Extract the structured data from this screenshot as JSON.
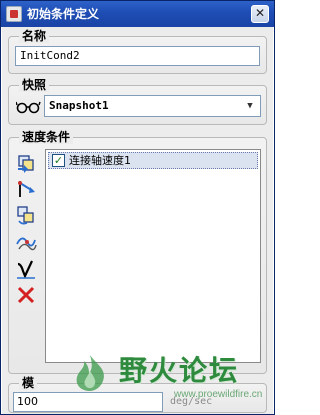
{
  "window": {
    "title": "初始条件定义",
    "close_label": "✕"
  },
  "name_group": {
    "legend": "名称",
    "value": "InitCond2"
  },
  "snapshot_group": {
    "legend": "快照",
    "selected": "Snapshot1"
  },
  "velocity_group": {
    "legend": "速度条件",
    "items": [
      {
        "label": "连接轴速度1",
        "checked": true
      }
    ]
  },
  "magnitude_group": {
    "legend": "模",
    "value": "100",
    "unit": "deg/sec"
  },
  "watermark": {
    "text": "野火论坛",
    "url": "www.proewildfire.cn"
  },
  "colors": {
    "title_bar": "#1e4db4",
    "dialog_bg": "#ececec",
    "delete_icon": "#d42020"
  }
}
